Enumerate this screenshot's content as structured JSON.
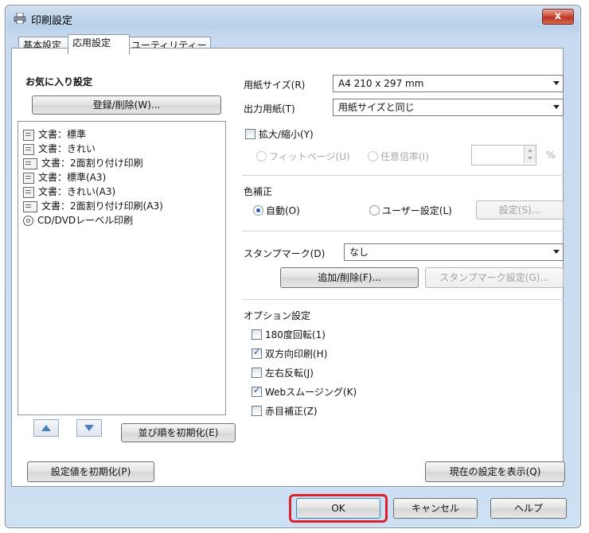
{
  "window": {
    "title": "印刷設定",
    "close_label": "x"
  },
  "tabs": [
    {
      "label": "基本設定"
    },
    {
      "label": "応用設定"
    },
    {
      "label": "ユーティリティー"
    }
  ],
  "favorites": {
    "title": "お気に入り設定",
    "register_button": "登録/削除(W)...",
    "items": [
      {
        "label": "文書：標準"
      },
      {
        "label": "文書：きれい"
      },
      {
        "label": "文書：2面割り付け印刷"
      },
      {
        "label": "文書：標準(A3)"
      },
      {
        "label": "文書：きれい(A3)"
      },
      {
        "label": "文書：2面割り付け印刷(A3)"
      },
      {
        "label": "CD/DVDレーベル印刷"
      }
    ],
    "reset_order_button": "並び順を初期化(E)"
  },
  "paper": {
    "size_label": "用紙サイズ(R)",
    "size_value": "A4 210 x 297 mm",
    "output_label": "出力用紙(T)",
    "output_value": "用紙サイズと同じ",
    "scale_label": "拡大/縮小(Y)",
    "fit_page_label": "フィットページ(U)",
    "any_ratio_label": "任意倍率(I)",
    "percent_unit": "%"
  },
  "color": {
    "title": "色補正",
    "auto_label": "自動(O)",
    "user_label": "ユーザー設定(L)",
    "settings_button": "設定(S)..."
  },
  "stamp": {
    "label": "スタンプマーク(D)",
    "value": "なし",
    "add_delete_button": "追加/削除(F)...",
    "settings_button": "スタンプマーク設定(G)..."
  },
  "options": {
    "title": "オプション設定",
    "items": [
      {
        "label": "180度回転(1)",
        "checked": false
      },
      {
        "label": "双方向印刷(H)",
        "checked": true
      },
      {
        "label": "左右反転(J)",
        "checked": false
      },
      {
        "label": "Webスムージング(K)",
        "checked": true
      },
      {
        "label": "赤目補正(Z)",
        "checked": false
      }
    ]
  },
  "bottom": {
    "reset_settings_button": "設定値を初期化(P)",
    "show_settings_button": "現在の設定を表示(Q)"
  },
  "dialog_buttons": {
    "ok": "OK",
    "cancel": "キャンセル",
    "help": "ヘルプ"
  },
  "colors": {
    "highlight": "#d9222a",
    "radio_dot": "#2b5bbf",
    "close": "#c7452f"
  }
}
